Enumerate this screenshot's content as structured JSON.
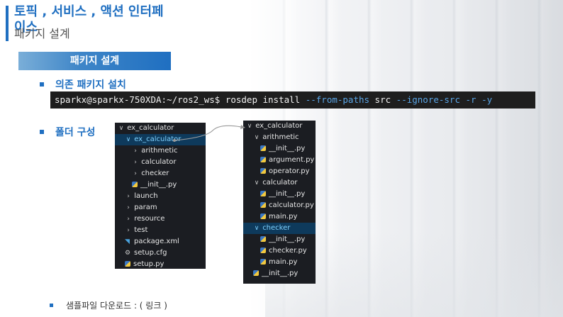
{
  "slide": {
    "title": "토픽 , 서비스 , 액션 인터페이스",
    "subtitle": "패키지 설계",
    "section": "패키지 설계"
  },
  "bullets": {
    "deps": "의존 패키지 설치",
    "folder": "폴더 구성"
  },
  "terminal": {
    "prompt": "sparkx@sparkx-750XDA:~/ros2_ws$ rosdep install ",
    "opt1": "--from-paths",
    "src": " src ",
    "opt2": "--ignore-src -r -y"
  },
  "tree_left": [
    {
      "label": "ex_calculator",
      "chev": "∨",
      "icon": "",
      "indent": 0,
      "sel": false
    },
    {
      "label": "ex_calculator",
      "chev": "∨",
      "icon": "",
      "indent": 1,
      "sel": true
    },
    {
      "label": "arithmetic",
      "chev": "›",
      "icon": "",
      "indent": 2,
      "sel": false
    },
    {
      "label": "calculator",
      "chev": "›",
      "icon": "",
      "indent": 2,
      "sel": false
    },
    {
      "label": "checker",
      "chev": "›",
      "icon": "",
      "indent": 2,
      "sel": false
    },
    {
      "label": "__init__.py",
      "chev": "",
      "icon": "py",
      "indent": 2,
      "sel": false
    },
    {
      "label": "launch",
      "chev": "›",
      "icon": "",
      "indent": 1,
      "sel": false
    },
    {
      "label": "param",
      "chev": "›",
      "icon": "",
      "indent": 1,
      "sel": false
    },
    {
      "label": "resource",
      "chev": "›",
      "icon": "",
      "indent": 1,
      "sel": false
    },
    {
      "label": "test",
      "chev": "›",
      "icon": "",
      "indent": 1,
      "sel": false
    },
    {
      "label": "package.xml",
      "chev": "",
      "icon": "rss",
      "indent": 1,
      "sel": false
    },
    {
      "label": "setup.cfg",
      "chev": "",
      "icon": "gear",
      "indent": 1,
      "sel": false
    },
    {
      "label": "setup.py",
      "chev": "",
      "icon": "py",
      "indent": 1,
      "sel": false
    }
  ],
  "tree_right": [
    {
      "label": "ex_calculator",
      "chev": "∨",
      "icon": "",
      "indent": 0,
      "sel": false
    },
    {
      "label": "arithmetic",
      "chev": "∨",
      "icon": "",
      "indent": 1,
      "sel": false
    },
    {
      "label": "__init__.py",
      "chev": "",
      "icon": "py",
      "indent": 2,
      "sel": false
    },
    {
      "label": "argument.py",
      "chev": "",
      "icon": "py",
      "indent": 2,
      "sel": false
    },
    {
      "label": "operator.py",
      "chev": "",
      "icon": "py",
      "indent": 2,
      "sel": false
    },
    {
      "label": "calculator",
      "chev": "∨",
      "icon": "",
      "indent": 1,
      "sel": false
    },
    {
      "label": "__init__.py",
      "chev": "",
      "icon": "py",
      "indent": 2,
      "sel": false
    },
    {
      "label": "calculator.py",
      "chev": "",
      "icon": "py",
      "indent": 2,
      "sel": false
    },
    {
      "label": "main.py",
      "chev": "",
      "icon": "py",
      "indent": 2,
      "sel": false
    },
    {
      "label": "checker",
      "chev": "∨",
      "icon": "",
      "indent": 1,
      "sel": true
    },
    {
      "label": "__init__.py",
      "chev": "",
      "icon": "py",
      "indent": 2,
      "sel": false
    },
    {
      "label": "checker.py",
      "chev": "",
      "icon": "py",
      "indent": 2,
      "sel": false
    },
    {
      "label": "main.py",
      "chev": "",
      "icon": "py",
      "indent": 2,
      "sel": false
    },
    {
      "label": "__init__.py",
      "chev": "",
      "icon": "py",
      "indent": 1,
      "sel": false
    }
  ],
  "footer": "샘플파일 다운로드 : ( 링크 )",
  "colors": {
    "accent": "#1f6fc1",
    "selected": "#0e3a5c",
    "tree_bg": "#1b1d22"
  }
}
